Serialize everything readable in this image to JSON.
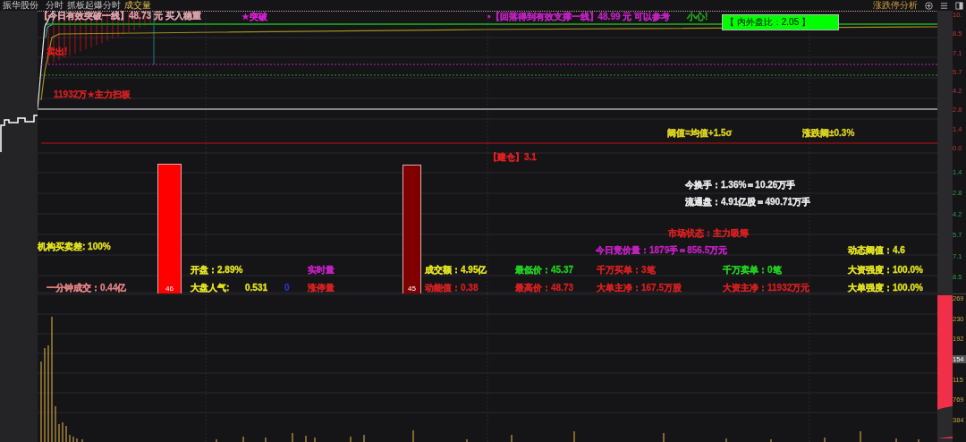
{
  "header": {
    "stock_name": "振华股份",
    "tabs": [
      {
        "label": "分时",
        "selected": false
      },
      {
        "label": "抓板起爆分时",
        "selected": false
      },
      {
        "label": "成交量",
        "selected": true
      }
    ],
    "panel_title": "涨跌停分析"
  },
  "price_panel": {
    "annotations": [
      {
        "text": "【今日有效突破一线】48.73 元 买入稳重",
        "color": "#d8a0a8"
      },
      {
        "text": "★突破",
        "color": "#d020d0"
      },
      {
        "text": "卖出!",
        "color": "#d02020"
      },
      {
        "text": "11932万★主力扫板",
        "color": "#d02020"
      },
      {
        "text": "•【回落得到有效支撑一线】48.99 元 可以参考",
        "color": "#c020c0"
      },
      {
        "text": "小心!",
        "color": "#20a020"
      },
      {
        "text": "阈值=均值+1.5σ",
        "color": "#d8d020"
      },
      {
        "text": "涨跌阈±0.3%",
        "color": "#d8d020"
      }
    ],
    "ratio_box": "【 内外盘比：2.05 】",
    "axis": [
      "10.",
      "8.5",
      "7.1",
      "5.7",
      "4.2",
      "2.8",
      "1.4",
      "0.0"
    ]
  },
  "indicator_panel": {
    "bars": [
      {
        "label": "46",
        "color": "#ff0000"
      },
      {
        "label": "45",
        "color": "#800000"
      }
    ],
    "stats": [
      {
        "text": "【建仓】3.1",
        "color": "#e02020"
      },
      {
        "text": "今换手：1.36%＝10.26万手",
        "color": "#e8e8e8"
      },
      {
        "text": "流通盘：4.91亿股＝490.71万手",
        "color": "#e8e8e8"
      },
      {
        "text": "市场状态：主力吸筹",
        "color": "#d02020"
      },
      {
        "text": "机构买卖差: 100%",
        "color": "#e0e020"
      },
      {
        "text": "今日竞价量：1879手＝856.5万元",
        "color": "#c020c0"
      },
      {
        "text": "动态阈值：4.6",
        "color": "#e0e020"
      },
      {
        "text": "开盘：2.89%",
        "color": "#e0e020"
      },
      {
        "text": "实时量",
        "color": "#c020c0"
      },
      {
        "text": "成交额：4.95亿",
        "color": "#e0e020"
      },
      {
        "text": "最低价：45.37",
        "color": "#20d020"
      },
      {
        "text": "千万买单：3笔",
        "color": "#d02020"
      },
      {
        "text": "千万卖单：0笔",
        "color": "#20d020"
      },
      {
        "text": "大资强度：100.0%",
        "color": "#e0e020"
      },
      {
        "text": "一分钟成交：0.44亿",
        "color": "#e08080"
      },
      {
        "text": "大盘人气:",
        "color": "#e0e020"
      },
      {
        "text": "0.531",
        "color": "#e0e020"
      },
      {
        "text": "0",
        "color": "#3030d0"
      },
      {
        "text": "涨停量",
        "color": "#d02020"
      },
      {
        "text": "动能值：0.38",
        "color": "#d02020"
      },
      {
        "text": "最高价：48.73",
        "color": "#d02020"
      },
      {
        "text": "大单主净：167.5万股",
        "color": "#d02020"
      },
      {
        "text": "大资主净：11932万元",
        "color": "#d02020"
      },
      {
        "text": "大单强度：100.0%",
        "color": "#e0e020"
      }
    ],
    "axis": [
      "1.4",
      "2.8",
      "4.2",
      "5.7",
      "7.1",
      "8.5"
    ]
  },
  "volume_panel": {
    "axis": [
      {
        "label": "269",
        "highlighted": false
      },
      {
        "label": "230",
        "highlighted": false
      },
      {
        "label": "192",
        "highlighted": false
      },
      {
        "label": "154",
        "highlighted": true
      },
      {
        "label": "115",
        "highlighted": false
      },
      {
        "label": "769",
        "highlighted": false
      },
      {
        "label": "384",
        "highlighted": false
      }
    ]
  }
}
